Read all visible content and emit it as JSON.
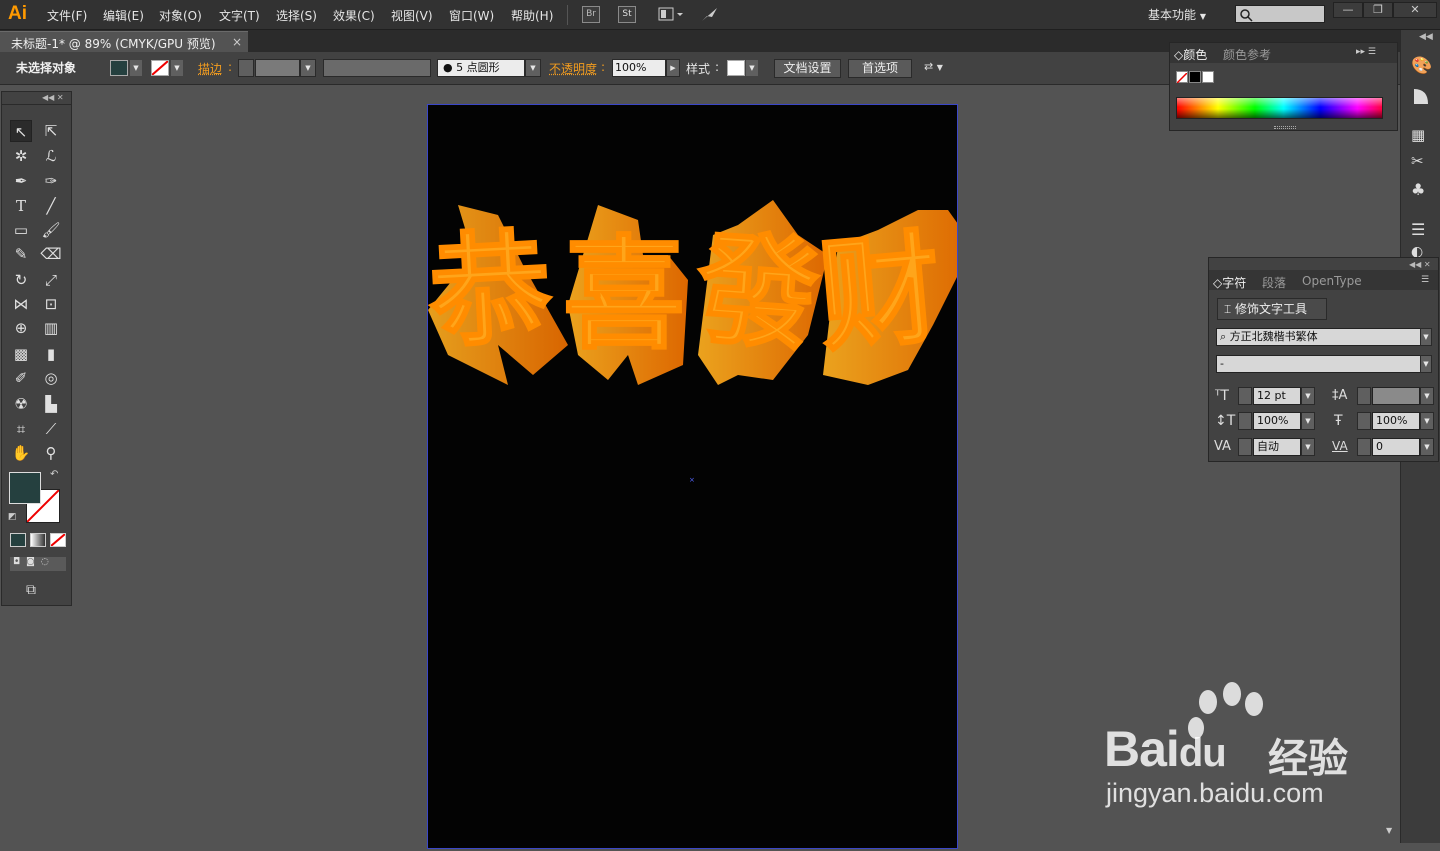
{
  "app": {
    "logo": "Ai"
  },
  "menus": [
    "文件(F)",
    "编辑(E)",
    "对象(O)",
    "文字(T)",
    "选择(S)",
    "效果(C)",
    "视图(V)",
    "窗口(W)",
    "帮助(H)"
  ],
  "toolbar_icons": {
    "bridge": "Br",
    "stock": "St"
  },
  "workspace": {
    "label": "基本功能"
  },
  "document_tab": {
    "title": "未标题-1* @ 89% (CMYK/GPU 预览)",
    "close": "×"
  },
  "control_bar": {
    "selection": "未选择对象",
    "stroke_label": "描边",
    "brush_value": "5",
    "brush_name": "点圆形",
    "opacity_label": "不透明度",
    "opacity_value": "100%",
    "style_label": "样式",
    "doc_setup": "文档设置",
    "preferences": "首选项"
  },
  "artwork": {
    "text": "恭喜发财",
    "chars": [
      "恭",
      "喜",
      "發",
      "财"
    ],
    "colors": {
      "top": "#f6a21a",
      "bottom": "#ff6a00",
      "background": "#030303",
      "artboard_border": "#3b47c9"
    }
  },
  "color_panel": {
    "tabs": [
      "颜色",
      "颜色参考"
    ]
  },
  "character_panel": {
    "tabs": [
      "字符",
      "段落",
      "OpenType"
    ],
    "touch_type_tool": "修饰文字工具",
    "font_family": "方正北魏楷书繁体",
    "font_style": "-",
    "font_size": "12 pt",
    "leading": "",
    "vertical_scale": "100%",
    "horizontal_scale": "100%",
    "kerning": "自动",
    "tracking": "0"
  },
  "watermark": {
    "brand": "Bai",
    "brand_du": "du",
    "brand_cn": "经验",
    "url": "jingyan.baidu.com"
  },
  "colors": {
    "fill_swatch": "#25403f",
    "accent_orange": "#f29c1f"
  }
}
